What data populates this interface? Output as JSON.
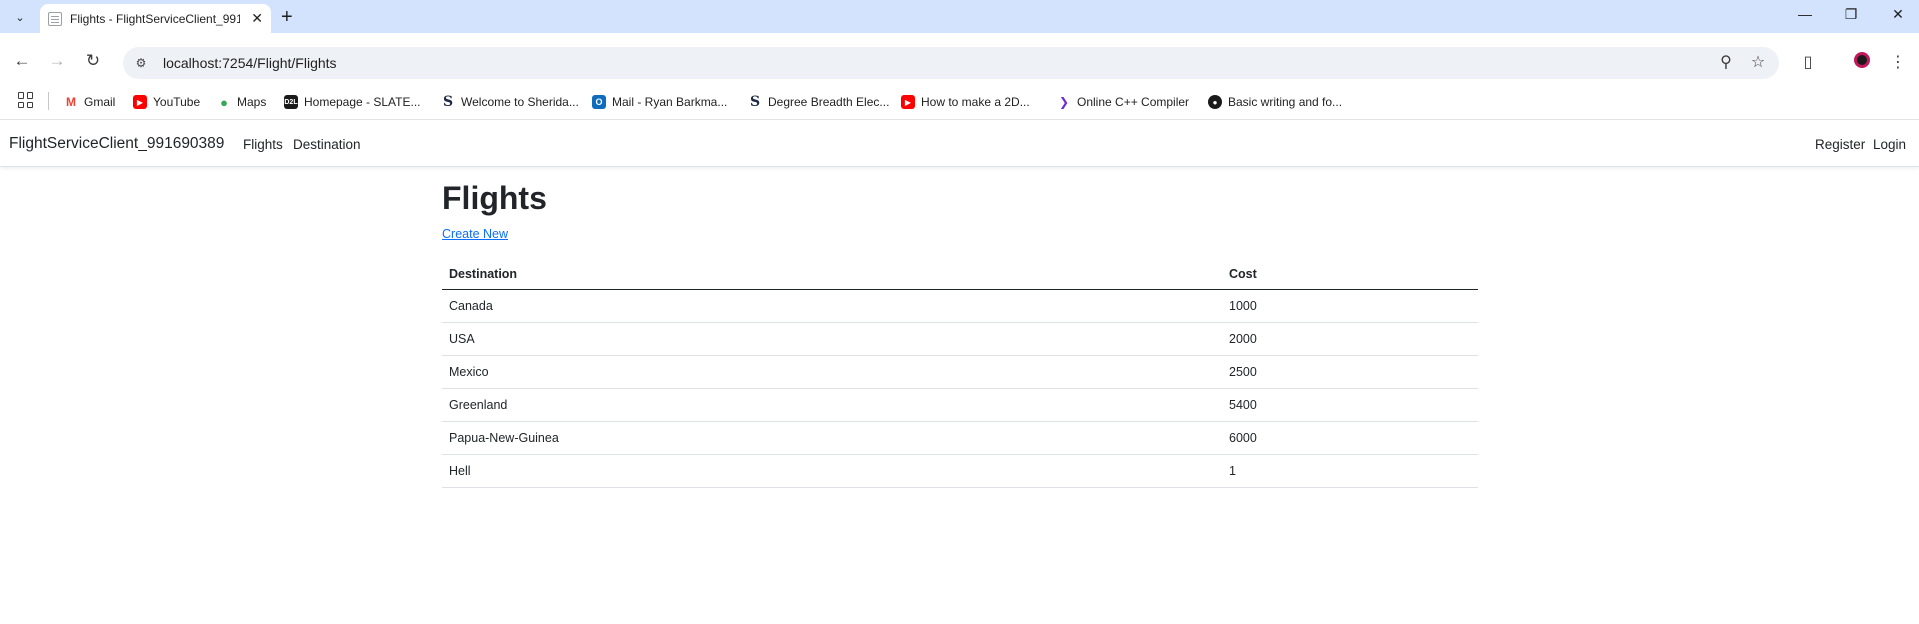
{
  "browser": {
    "tab_title": "Flights - FlightServiceClient_991690389",
    "url": "localhost:7254/Flight/Flights",
    "bookmarks": [
      {
        "label": "Gmail",
        "icon": "gmail-icon"
      },
      {
        "label": "YouTube",
        "icon": "youtube-icon"
      },
      {
        "label": "Maps",
        "icon": "maps-icon"
      },
      {
        "label": "Homepage - SLATE...",
        "icon": "d2l-icon"
      },
      {
        "label": "Welcome to Sherida...",
        "icon": "sheridan-icon"
      },
      {
        "label": "Mail - Ryan Barkma...",
        "icon": "outlook-icon"
      },
      {
        "label": "Degree Breadth Elec...",
        "icon": "sheridan-icon"
      },
      {
        "label": "How to make a 2D...",
        "icon": "youtube-icon"
      },
      {
        "label": "Online C++ Compiler",
        "icon": "compiler-icon"
      },
      {
        "label": "Basic writing and fo...",
        "icon": "github-icon"
      }
    ]
  },
  "site": {
    "brand": "FlightServiceClient_991690389",
    "nav": {
      "flights": "Flights",
      "destination": "Destination"
    },
    "auth": {
      "register": "Register",
      "login": "Login"
    }
  },
  "main": {
    "title": "Flights",
    "create_link": "Create New",
    "table": {
      "headers": {
        "destination": "Destination",
        "cost": "Cost"
      },
      "rows": [
        {
          "destination": "Canada",
          "cost": "1000"
        },
        {
          "destination": "USA",
          "cost": "2000"
        },
        {
          "destination": "Mexico",
          "cost": "2500"
        },
        {
          "destination": "Greenland",
          "cost": "5400"
        },
        {
          "destination": "Papua-New-Guinea",
          "cost": "6000"
        },
        {
          "destination": "Hell",
          "cost": "1"
        }
      ]
    }
  },
  "colors": {
    "tabstrip": "#d3e3fd",
    "link": "#0d6efd",
    "text": "#212529"
  }
}
